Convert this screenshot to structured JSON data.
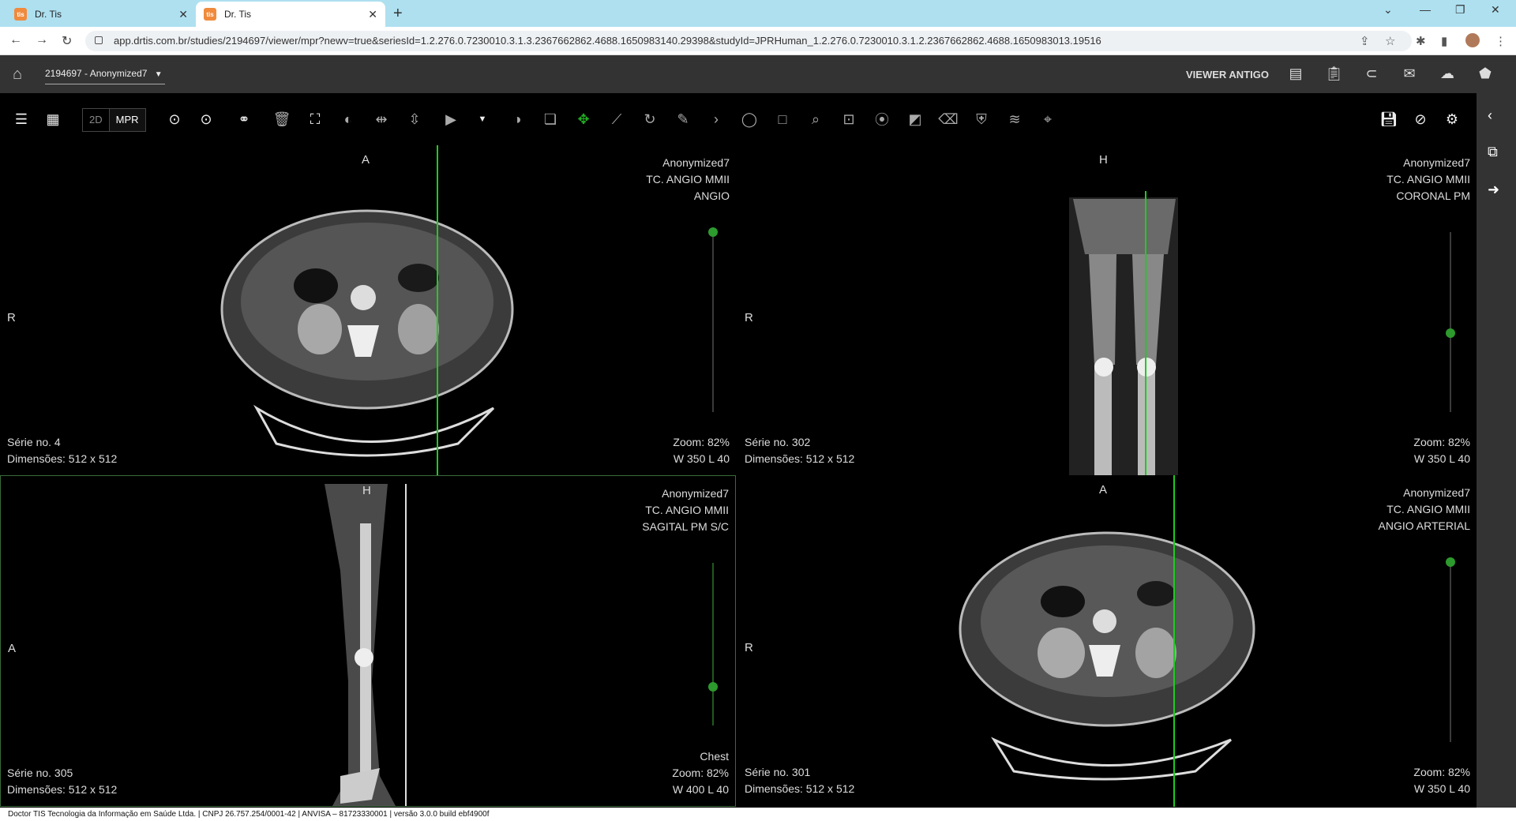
{
  "browser": {
    "tabs": [
      {
        "title": "Dr. Tis",
        "active": false
      },
      {
        "title": "Dr. Tis",
        "active": true
      }
    ],
    "url": "app.drtis.com.br/studies/2194697/viewer/mpr?newv=true&seriesId=1.2.276.0.7230010.3.1.3.2367662862.4688.1650983140.29398&studyId=JPRHuman_1.2.276.0.7230010.3.1.2.2367662862.4688.1650983013.19516"
  },
  "header": {
    "study_selector": "2194697 - Anonymized7",
    "old_viewer": "VIEWER ANTIGO"
  },
  "toolbar": {
    "mode_2d": "2D",
    "mode_mpr": "MPR"
  },
  "viewports": [
    {
      "orient_top": "A",
      "orient_left": "R",
      "patient": "Anonymized7",
      "study": "TC. ANGIO MMII",
      "series_desc": "ANGIO",
      "series_no": "Série no. 4",
      "dims": "Dimensões: 512 x 512",
      "preset": "",
      "zoom": "Zoom: 82%",
      "window": "W 350 L 40",
      "slider_pos": 0.0
    },
    {
      "orient_top": "H",
      "orient_left": "R",
      "patient": "Anonymized7",
      "study": "TC. ANGIO MMII",
      "series_desc": "CORONAL PM",
      "series_no": "Série no. 302",
      "dims": "Dimensões: 512 x 512",
      "preset": "",
      "zoom": "Zoom: 82%",
      "window": "W 350 L 40",
      "slider_pos": 0.56
    },
    {
      "orient_top": "H",
      "orient_left": "A",
      "patient": "Anonymized7",
      "study": "TC. ANGIO MMII",
      "series_desc": "SAGITAL PM S/C",
      "series_no": "Série no. 305",
      "dims": "Dimensões: 512 x 512",
      "preset": "Chest",
      "zoom": "Zoom: 82%",
      "window": "W 400 L 40",
      "slider_pos": 0.76
    },
    {
      "orient_top": "A",
      "orient_left": "R",
      "patient": "Anonymized7",
      "study": "TC. ANGIO MMII",
      "series_desc": "ANGIO ARTERIAL",
      "series_no": "Série no. 301",
      "dims": "Dimensões: 512 x 512",
      "preset": "",
      "zoom": "Zoom: 82%",
      "window": "W 350 L 40",
      "slider_pos": 0.0
    }
  ],
  "footer": "Doctor TIS Tecnologia da Informação em Saúde Ltda. | CNPJ 26.757.254/0001-42 | ANVISA – 81723330001 | versão 3.0.0 build ebf4900f"
}
